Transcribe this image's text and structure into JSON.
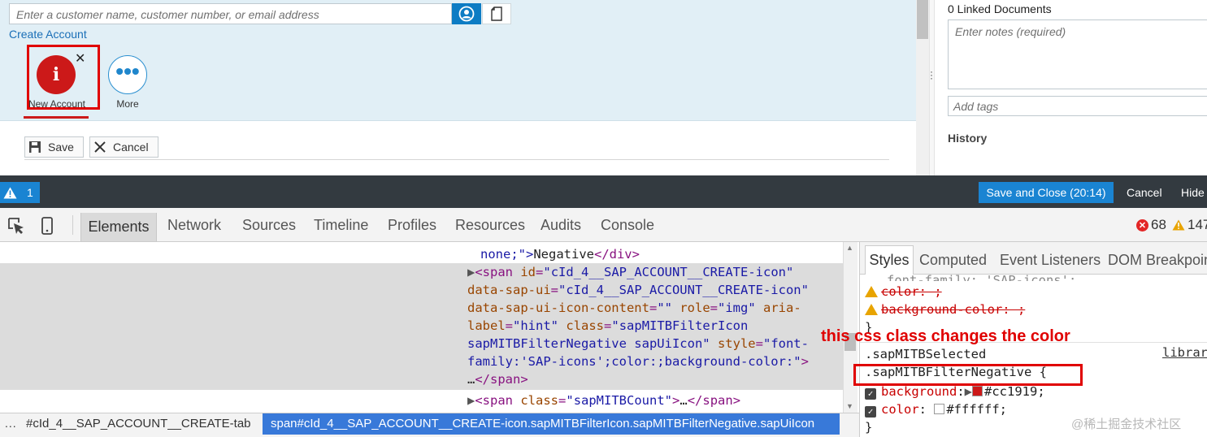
{
  "app": {
    "search_placeholder": "Enter a customer name, customer number, or email address",
    "create_account_link": "Create Account",
    "tiles": [
      {
        "label": "New Account",
        "icon": "info-icon",
        "glyph": "i",
        "close_glyph": "✕",
        "color": "#cc1919"
      },
      {
        "label": "More",
        "icon": "more-icon",
        "glyph": "•••"
      }
    ],
    "buttons": {
      "save": "Save",
      "cancel": "Cancel"
    },
    "right_panel": {
      "linked_documents": "0 Linked Documents",
      "notes_placeholder": "Enter notes (required)",
      "tags_placeholder": "Add tags",
      "history": "History"
    }
  },
  "toolbar": {
    "warning_count": "1",
    "save_and_close": "Save and Close (20:14)",
    "cancel": "Cancel",
    "hide": "Hide",
    "accent_color": "#1a84d2"
  },
  "devtools": {
    "tabs": [
      "Elements",
      "Network",
      "Sources",
      "Timeline",
      "Profiles",
      "Resources",
      "Audits",
      "Console"
    ],
    "active_tab": "Elements",
    "error_count": "68",
    "warning_count": "147",
    "elements": {
      "line0": {
        "text": "none;\">",
        "content": "Negative",
        "close": "</div>"
      },
      "span_icon": {
        "id_value": "\"cId_4__SAP_ACCOUNT__CREATE-icon\"",
        "data_sap_ui_value": "\"cId_4__SAP_ACCOUNT__CREATE-icon\"",
        "icon_content_value": "\"\"",
        "role_value": "\"img\"",
        "aria_label_value": "\"hint\"",
        "class_value_1": "\"sapMITBFilterIcon",
        "class_value_2": "sapMITBFilterNegative sapUiIcon\"",
        "style_value_1": "\"font-",
        "style_value_2": "family:'SAP-icons';color:;background-color:\"",
        "ellipsis": "…"
      },
      "span_count": {
        "class_value": "\"sapMITBCount\"",
        "ellipsis": "…"
      }
    },
    "breadcrumb": {
      "item1": "#cId_4__SAP_ACCOUNT__CREATE-tab",
      "item2": "span#cId_4__SAP_ACCOUNT__CREATE-icon.sapMITBFilterIcon.sapMITBFilterNegative.sapUiIcon"
    },
    "styles": {
      "tabs": [
        "Styles",
        "Computed",
        "Event Listeners",
        "DOM Breakpoints"
      ],
      "prev_rule_tail": "font-family: 'SAP-icons';",
      "invalid_props": [
        "color: ;",
        "background-color: ;"
      ],
      "selector_1": ".sapMITBSelected",
      "library_link": "library",
      "selector_2": ".sapMITBFilterNegative {",
      "rules": [
        {
          "prop": "background",
          "value": "#cc1919",
          "swatch": "#cc1919"
        },
        {
          "prop": "color",
          "value": "#ffffff",
          "swatch": "#ffffff"
        }
      ]
    }
  },
  "annotation": "this css class changes the color",
  "watermark": "@稀土掘金技术社区"
}
